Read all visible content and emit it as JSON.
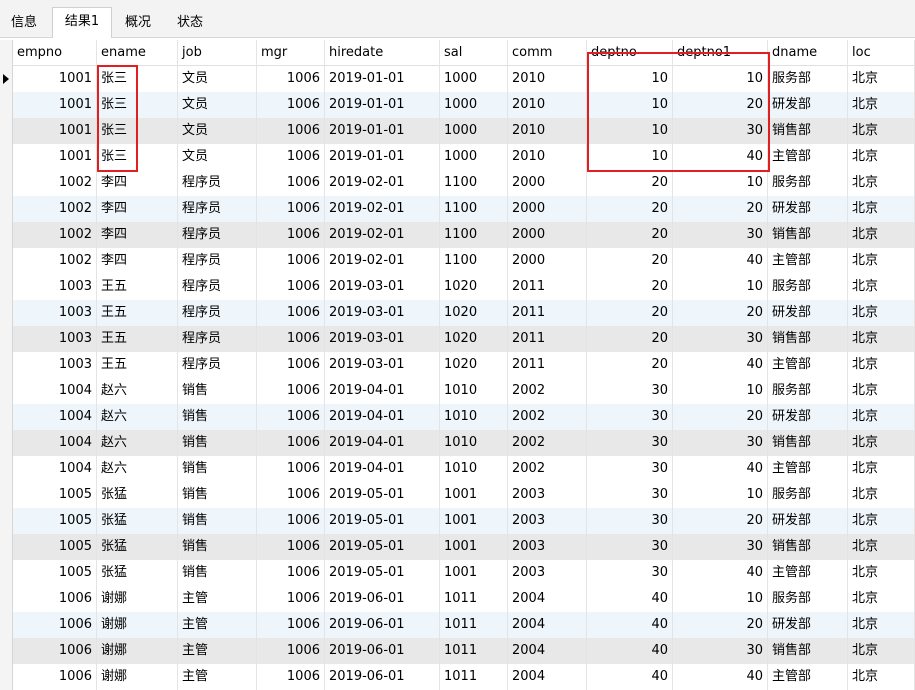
{
  "tabs": [
    "信息",
    "结果1",
    "概况",
    "状态"
  ],
  "columns": [
    "empno",
    "ename",
    "job",
    "mgr",
    "hiredate",
    "sal",
    "comm",
    "deptno",
    "deptno1",
    "dname",
    "loc"
  ],
  "rows": [
    [
      "1001",
      "张三",
      "文员",
      "1006",
      "2019-01-01",
      "1000",
      "2010",
      "10",
      "10",
      "服务部",
      "北京"
    ],
    [
      "1001",
      "张三",
      "文员",
      "1006",
      "2019-01-01",
      "1000",
      "2010",
      "10",
      "20",
      "研发部",
      "北京"
    ],
    [
      "1001",
      "张三",
      "文员",
      "1006",
      "2019-01-01",
      "1000",
      "2010",
      "10",
      "30",
      "销售部",
      "北京"
    ],
    [
      "1001",
      "张三",
      "文员",
      "1006",
      "2019-01-01",
      "1000",
      "2010",
      "10",
      "40",
      "主管部",
      "北京"
    ],
    [
      "1002",
      "李四",
      "程序员",
      "1006",
      "2019-02-01",
      "1100",
      "2000",
      "20",
      "10",
      "服务部",
      "北京"
    ],
    [
      "1002",
      "李四",
      "程序员",
      "1006",
      "2019-02-01",
      "1100",
      "2000",
      "20",
      "20",
      "研发部",
      "北京"
    ],
    [
      "1002",
      "李四",
      "程序员",
      "1006",
      "2019-02-01",
      "1100",
      "2000",
      "20",
      "30",
      "销售部",
      "北京"
    ],
    [
      "1002",
      "李四",
      "程序员",
      "1006",
      "2019-02-01",
      "1100",
      "2000",
      "20",
      "40",
      "主管部",
      "北京"
    ],
    [
      "1003",
      "王五",
      "程序员",
      "1006",
      "2019-03-01",
      "1020",
      "2011",
      "20",
      "10",
      "服务部",
      "北京"
    ],
    [
      "1003",
      "王五",
      "程序员",
      "1006",
      "2019-03-01",
      "1020",
      "2011",
      "20",
      "20",
      "研发部",
      "北京"
    ],
    [
      "1003",
      "王五",
      "程序员",
      "1006",
      "2019-03-01",
      "1020",
      "2011",
      "20",
      "30",
      "销售部",
      "北京"
    ],
    [
      "1003",
      "王五",
      "程序员",
      "1006",
      "2019-03-01",
      "1020",
      "2011",
      "20",
      "40",
      "主管部",
      "北京"
    ],
    [
      "1004",
      "赵六",
      "销售",
      "1006",
      "2019-04-01",
      "1010",
      "2002",
      "30",
      "10",
      "服务部",
      "北京"
    ],
    [
      "1004",
      "赵六",
      "销售",
      "1006",
      "2019-04-01",
      "1010",
      "2002",
      "30",
      "20",
      "研发部",
      "北京"
    ],
    [
      "1004",
      "赵六",
      "销售",
      "1006",
      "2019-04-01",
      "1010",
      "2002",
      "30",
      "30",
      "销售部",
      "北京"
    ],
    [
      "1004",
      "赵六",
      "销售",
      "1006",
      "2019-04-01",
      "1010",
      "2002",
      "30",
      "40",
      "主管部",
      "北京"
    ],
    [
      "1005",
      "张猛",
      "销售",
      "1006",
      "2019-05-01",
      "1001",
      "2003",
      "30",
      "10",
      "服务部",
      "北京"
    ],
    [
      "1005",
      "张猛",
      "销售",
      "1006",
      "2019-05-01",
      "1001",
      "2003",
      "30",
      "20",
      "研发部",
      "北京"
    ],
    [
      "1005",
      "张猛",
      "销售",
      "1006",
      "2019-05-01",
      "1001",
      "2003",
      "30",
      "30",
      "销售部",
      "北京"
    ],
    [
      "1005",
      "张猛",
      "销售",
      "1006",
      "2019-05-01",
      "1001",
      "2003",
      "30",
      "40",
      "主管部",
      "北京"
    ],
    [
      "1006",
      "谢娜",
      "主管",
      "1006",
      "2019-06-01",
      "1011",
      "2004",
      "40",
      "10",
      "服务部",
      "北京"
    ],
    [
      "1006",
      "谢娜",
      "主管",
      "1006",
      "2019-06-01",
      "1011",
      "2004",
      "40",
      "20",
      "研发部",
      "北京"
    ],
    [
      "1006",
      "谢娜",
      "主管",
      "1006",
      "2019-06-01",
      "1011",
      "2004",
      "40",
      "30",
      "销售部",
      "北京"
    ],
    [
      "1006",
      "谢娜",
      "主管",
      "1006",
      "2019-06-01",
      "1011",
      "2004",
      "40",
      "40",
      "主管部",
      "北京"
    ]
  ],
  "colors": {
    "highlight_box": "#e02020",
    "alt_row": "#eef5fb",
    "selected_row": "#e8e8e8"
  }
}
